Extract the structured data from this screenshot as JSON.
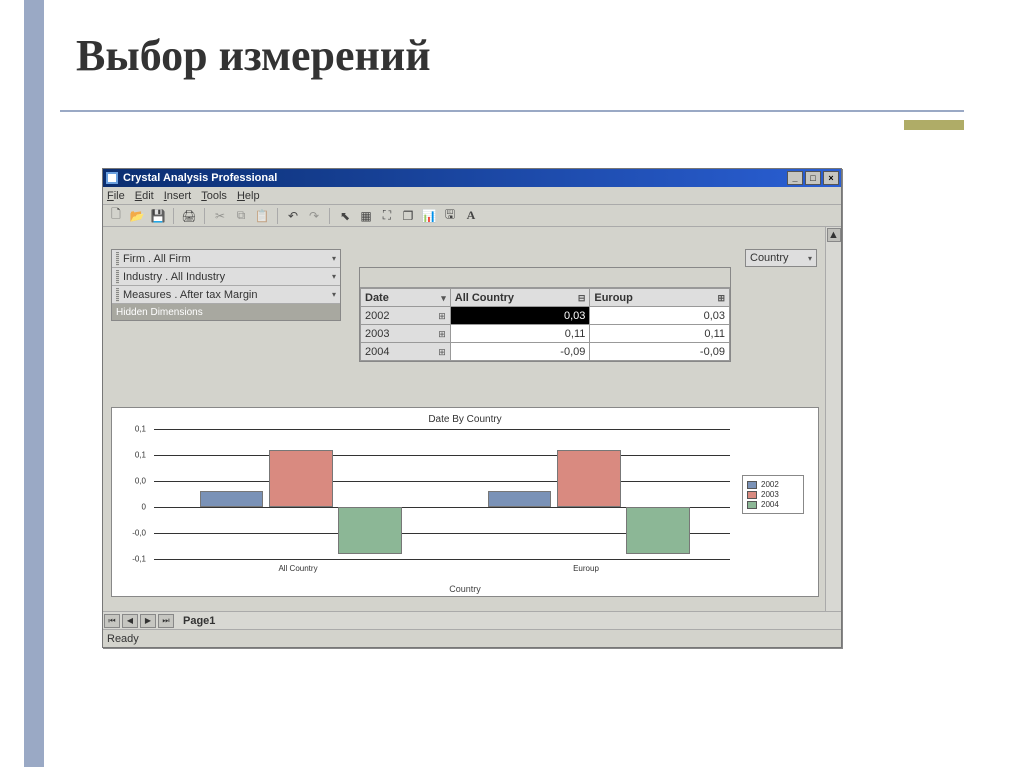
{
  "slide": {
    "title": "Выбор измерений"
  },
  "window": {
    "title": "Crystal Analysis Professional",
    "menu": [
      "File",
      "Edit",
      "Insert",
      "Tools",
      "Help"
    ]
  },
  "toolbar_icons": [
    "new",
    "open",
    "save",
    "print",
    "cut",
    "copy",
    "paste",
    "undo",
    "redo",
    "pointer",
    "table",
    "crop",
    "window",
    "chart",
    "save2",
    "text"
  ],
  "dimensions": {
    "rows": [
      "Firm . All Firm",
      "Industry . All Industry",
      "Measures . After tax Margin"
    ],
    "hidden_label": "Hidden Dimensions"
  },
  "column_selector": {
    "label": "Country"
  },
  "table": {
    "row_header": "Date",
    "col_headers": [
      "All Country",
      "Euroup"
    ],
    "rows": [
      {
        "label": "2002",
        "all": "0,03",
        "eur": "0,03"
      },
      {
        "label": "2003",
        "all": "0,11",
        "eur": "0,11"
      },
      {
        "label": "2004",
        "all": "-0,09",
        "eur": "-0,09"
      }
    ]
  },
  "chart": {
    "title": "Date By Country",
    "xlabel": "Country",
    "categories": [
      "All Country",
      "Euroup"
    ],
    "y_ticks": [
      "0,1",
      "0,1",
      "0,0",
      "0",
      "-0,0",
      "-0,1"
    ]
  },
  "chart_data": {
    "type": "bar",
    "title": "Date By Country",
    "xlabel": "Country",
    "ylabel": "",
    "ylim": [
      -0.1,
      0.15
    ],
    "categories": [
      "All Country",
      "Euroup"
    ],
    "series": [
      {
        "name": "2002",
        "values": [
          0.03,
          0.03
        ]
      },
      {
        "name": "2003",
        "values": [
          0.11,
          0.11
        ]
      },
      {
        "name": "2004",
        "values": [
          -0.09,
          -0.09
        ]
      }
    ]
  },
  "page_tab": "Page1",
  "status": "Ready"
}
